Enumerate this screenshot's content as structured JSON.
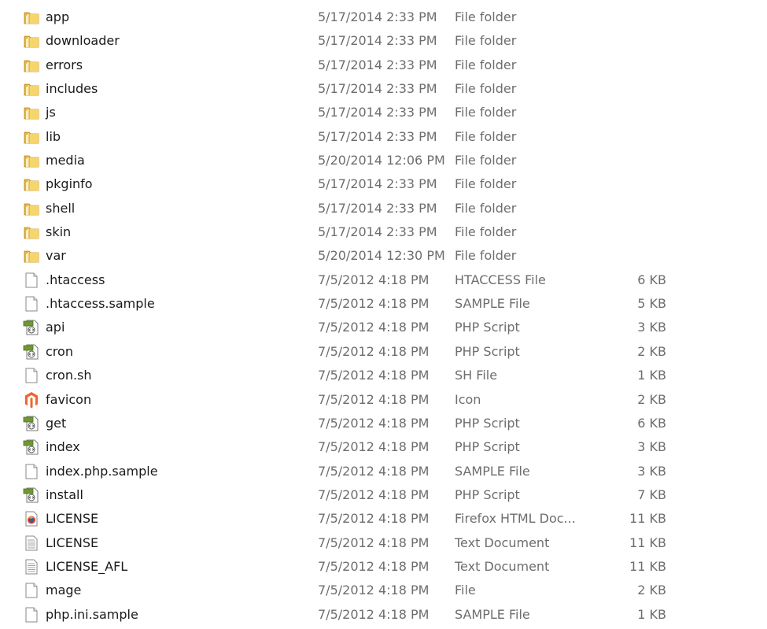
{
  "files": [
    {
      "icon": "folder-icon",
      "name": "app",
      "date": "5/17/2014 2:33 PM",
      "type": "File folder",
      "size": ""
    },
    {
      "icon": "folder-icon",
      "name": "downloader",
      "date": "5/17/2014 2:33 PM",
      "type": "File folder",
      "size": ""
    },
    {
      "icon": "folder-icon",
      "name": "errors",
      "date": "5/17/2014 2:33 PM",
      "type": "File folder",
      "size": ""
    },
    {
      "icon": "folder-icon",
      "name": "includes",
      "date": "5/17/2014 2:33 PM",
      "type": "File folder",
      "size": ""
    },
    {
      "icon": "folder-icon",
      "name": "js",
      "date": "5/17/2014 2:33 PM",
      "type": "File folder",
      "size": ""
    },
    {
      "icon": "folder-icon",
      "name": "lib",
      "date": "5/17/2014 2:33 PM",
      "type": "File folder",
      "size": ""
    },
    {
      "icon": "folder-icon",
      "name": "media",
      "date": "5/20/2014 12:06 PM",
      "type": "File folder",
      "size": ""
    },
    {
      "icon": "folder-icon",
      "name": "pkginfo",
      "date": "5/17/2014 2:33 PM",
      "type": "File folder",
      "size": ""
    },
    {
      "icon": "folder-icon",
      "name": "shell",
      "date": "5/17/2014 2:33 PM",
      "type": "File folder",
      "size": ""
    },
    {
      "icon": "folder-icon",
      "name": "skin",
      "date": "5/17/2014 2:33 PM",
      "type": "File folder",
      "size": ""
    },
    {
      "icon": "folder-icon",
      "name": "var",
      "date": "5/20/2014 12:30 PM",
      "type": "File folder",
      "size": ""
    },
    {
      "icon": "blank-file-icon",
      "name": ".htaccess",
      "date": "7/5/2012 4:18 PM",
      "type": "HTACCESS File",
      "size": "6 KB"
    },
    {
      "icon": "blank-file-icon",
      "name": ".htaccess.sample",
      "date": "7/5/2012 4:18 PM",
      "type": "SAMPLE File",
      "size": "5 KB"
    },
    {
      "icon": "php-script-icon",
      "name": "api",
      "date": "7/5/2012 4:18 PM",
      "type": "PHP Script",
      "size": "3 KB"
    },
    {
      "icon": "php-script-icon",
      "name": "cron",
      "date": "7/5/2012 4:18 PM",
      "type": "PHP Script",
      "size": "2 KB"
    },
    {
      "icon": "blank-file-icon",
      "name": "cron.sh",
      "date": "7/5/2012 4:18 PM",
      "type": "SH File",
      "size": "1 KB"
    },
    {
      "icon": "magento-logo-icon",
      "name": "favicon",
      "date": "7/5/2012 4:18 PM",
      "type": "Icon",
      "size": "2 KB"
    },
    {
      "icon": "php-script-icon",
      "name": "get",
      "date": "7/5/2012 4:18 PM",
      "type": "PHP Script",
      "size": "6 KB"
    },
    {
      "icon": "php-script-icon",
      "name": "index",
      "date": "7/5/2012 4:18 PM",
      "type": "PHP Script",
      "size": "3 KB"
    },
    {
      "icon": "blank-file-icon",
      "name": "index.php.sample",
      "date": "7/5/2012 4:18 PM",
      "type": "SAMPLE File",
      "size": "3 KB"
    },
    {
      "icon": "php-script-icon",
      "name": "install",
      "date": "7/5/2012 4:18 PM",
      "type": "PHP Script",
      "size": "7 KB"
    },
    {
      "icon": "firefox-html-icon",
      "name": "LICENSE",
      "date": "7/5/2012 4:18 PM",
      "type": "Firefox HTML Doc...",
      "size": "11 KB"
    },
    {
      "icon": "text-document-icon",
      "name": "LICENSE",
      "date": "7/5/2012 4:18 PM",
      "type": "Text Document",
      "size": "11 KB"
    },
    {
      "icon": "text-document-icon",
      "name": "LICENSE_AFL",
      "date": "7/5/2012 4:18 PM",
      "type": "Text Document",
      "size": "11 KB"
    },
    {
      "icon": "blank-file-icon",
      "name": "mage",
      "date": "7/5/2012 4:18 PM",
      "type": "File",
      "size": "2 KB"
    },
    {
      "icon": "blank-file-icon",
      "name": "php.ini.sample",
      "date": "7/5/2012 4:18 PM",
      "type": "SAMPLE File",
      "size": "1 KB"
    }
  ]
}
